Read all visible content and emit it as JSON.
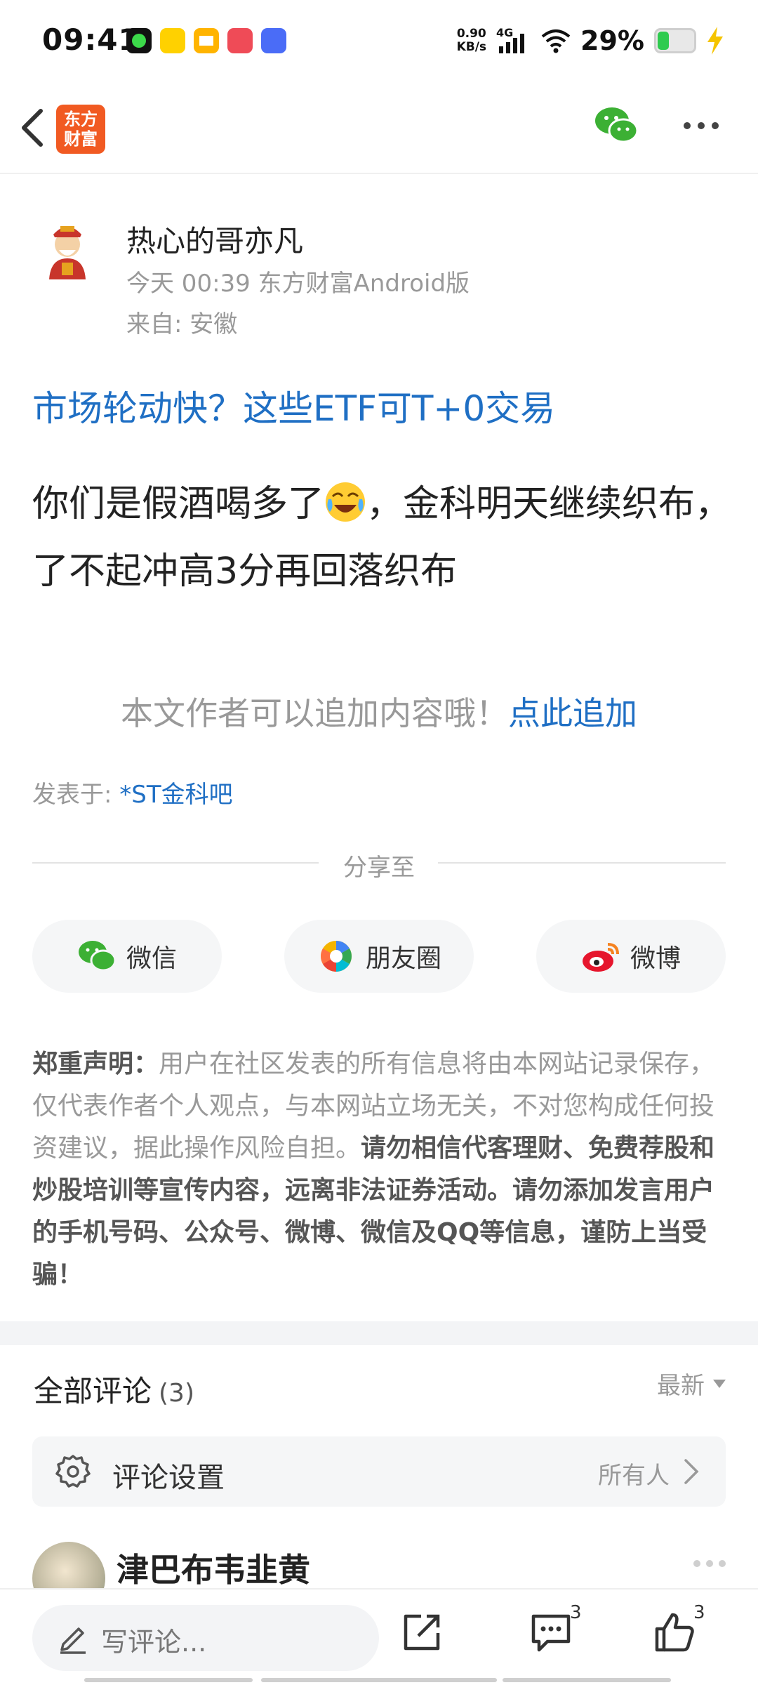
{
  "status_bar": {
    "time": "09:41",
    "net_speed_value": "0.90",
    "net_speed_unit": "KB/s",
    "network": "4G",
    "battery_percent": "29%",
    "battery_level": 0.29,
    "app_icons": [
      "green-app-icon",
      "meituan-icon",
      "mail-app-icon",
      "red-app-icon",
      "vivo-icon"
    ]
  },
  "header": {
    "logo_line1": "东方",
    "logo_line2": "财富"
  },
  "post": {
    "author": "热心的哥亦凡",
    "meta": "今天 00:39 东方财富Android版",
    "location": "来自: 安徽",
    "title": "市场轮动快？这些ETF可T+0交易",
    "body_part1": "你们是假酒喝多了",
    "body_part2": "，金科明天继续织布，了不起冲高3分再回落织布",
    "append_prompt": "本文作者可以追加内容哦！",
    "append_link": "点此追加",
    "posted_in_label": "发表于: ",
    "posted_in_link": "*ST金科吧"
  },
  "share": {
    "label": "分享至",
    "wechat": "微信",
    "moments": "朋友圈",
    "weibo": "微博"
  },
  "disclaimer": {
    "heading": "郑重声明：",
    "normal": "用户在社区发表的所有信息将由本网站记录保存，仅代表作者个人观点，与本网站立场无关，不对您构成任何投资建议，据此操作风险自担。",
    "bold": "请勿相信代客理财、免费荐股和炒股培训等宣传内容，远离非法证券活动。请勿添加发言用户的手机号码、公众号、微博、微信及QQ等信息，谨防上当受骗！"
  },
  "comments": {
    "title": "全部评论",
    "count": "(3)",
    "sort": "最新",
    "settings_label": "评论设置",
    "settings_value": "所有人",
    "first_commenter": "津巴布韦韭黄"
  },
  "bottom_bar": {
    "write_placeholder": "写评论...",
    "comment_count": "3",
    "like_count": "3"
  },
  "colors": {
    "link_blue": "#1f6fc4",
    "brand_orange": "#f15a22",
    "wechat_green": "#3cb034"
  }
}
